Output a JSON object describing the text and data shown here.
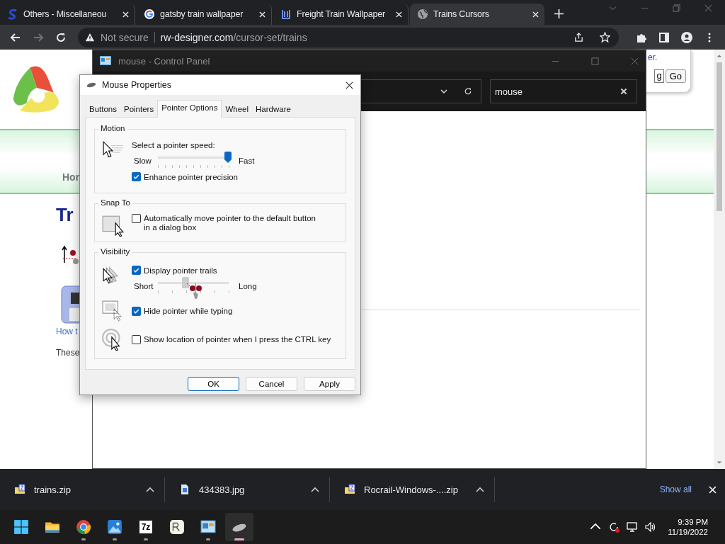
{
  "browser": {
    "tabs": [
      {
        "title": "Others - Miscellaneou",
        "kind": "s-logo",
        "selected": false
      },
      {
        "title": "gatsby train wallpaper",
        "kind": "google",
        "selected": false
      },
      {
        "title": "Freight Train Wallpaper",
        "kind": "freight",
        "selected": false
      },
      {
        "title": "Trains Cursors",
        "kind": "globe",
        "selected": true
      }
    ],
    "security": "Not secure",
    "url_domain": "rw-designer.com",
    "url_path": "/cursor-set/trains"
  },
  "web_page": {
    "top_link_fragment": "er.",
    "search_value": "g",
    "go_button": "Go",
    "nav_fragment": "Hor",
    "title_fragment": "Tr",
    "link_fragment": "How t",
    "text_fragment": "These"
  },
  "control_panel": {
    "title": "mouse - Control Panel",
    "search_value": "mouse"
  },
  "dialog": {
    "title": "Mouse Properties",
    "tabs": [
      {
        "label": "Buttons",
        "selected": false
      },
      {
        "label": "Pointers",
        "selected": false
      },
      {
        "label": "Pointer Options",
        "selected": true
      },
      {
        "label": "Wheel",
        "selected": false
      },
      {
        "label": "Hardware",
        "selected": false
      }
    ],
    "motion": {
      "title": "Motion",
      "prompt": "Select a pointer speed:",
      "slider": {
        "min_label": "Slow",
        "max_label": "Fast",
        "level": 1.0
      },
      "precision": {
        "label": "Enhance pointer precision",
        "checked": true
      }
    },
    "snap_to": {
      "title": "Snap To",
      "option": {
        "label": "Automatically move pointer to the default button in a dialog box",
        "checked": false
      }
    },
    "visibility": {
      "title": "Visibility",
      "trails": {
        "label": "Display pointer trails",
        "checked": true
      },
      "trail_slider": {
        "min_label": "Short",
        "max_label": "Long",
        "level": 0.4
      },
      "hide_typing": {
        "label": "Hide pointer while typing",
        "checked": true
      },
      "show_location": {
        "label": "Show location of pointer when I press the CTRL key",
        "checked": false
      }
    },
    "buttons": [
      {
        "label": "OK",
        "default": true
      },
      {
        "label": "Cancel",
        "default": false
      },
      {
        "label": "Apply",
        "default": false
      }
    ]
  },
  "downloads": {
    "items": [
      {
        "name": "trains.zip",
        "kind": "zip"
      },
      {
        "name": "434383.jpg",
        "kind": "image"
      },
      {
        "name": "Rocrail-Windows-....zip",
        "kind": "zip"
      }
    ],
    "show_all": "Show all"
  },
  "taskbar": {
    "apps": [
      {
        "kind": "start",
        "running": false,
        "active": false
      },
      {
        "kind": "folder",
        "running": false,
        "active": false
      },
      {
        "kind": "chrome",
        "running": true,
        "active": false
      },
      {
        "kind": "photos",
        "running": true,
        "active": false
      },
      {
        "kind": "archive",
        "label": "7z",
        "running": true,
        "active": false
      },
      {
        "kind": "rocrail",
        "running": false,
        "active": false
      },
      {
        "kind": "control-panel",
        "running": true,
        "active": false
      },
      {
        "kind": "mouse",
        "running": true,
        "active": true
      }
    ],
    "time": "9:39 PM",
    "date": "11/19/2022"
  }
}
